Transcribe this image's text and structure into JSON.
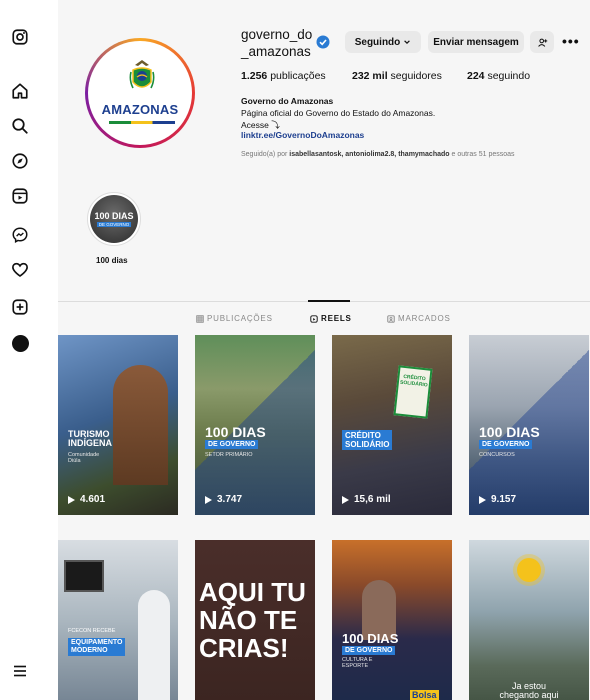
{
  "sidebar": {
    "icons": [
      "instagram-logo-icon",
      "home-icon",
      "search-icon",
      "explore-icon",
      "reels-icon",
      "messenger-icon",
      "heart-icon",
      "create-icon",
      "profile-avatar",
      "menu-icon"
    ]
  },
  "profile": {
    "username": "governo_do\n_amazonas",
    "verified": true,
    "avatar_brand": "AMAZONAS",
    "buttons": {
      "following": "Seguindo",
      "message": "Enviar mensagem"
    },
    "stats": {
      "posts": "1.256",
      "posts_label": "publicações",
      "followers": "232 mil",
      "followers_label": "seguidores",
      "following": "224",
      "following_label": "seguindo"
    },
    "bio": {
      "name": "Governo do Amazonas",
      "line1": "Página oficial do Governo do Estado do Amazonas.",
      "line2": "Acesse ⤵",
      "link": "linktr.ee/GovernoDoAmazonas"
    },
    "followed_by": {
      "prefix": "Seguido(a) por ",
      "names": "isabellasantosk, antoniolima2.8, thamymachado",
      "suffix": " e outras 51 pessoas"
    }
  },
  "highlights": [
    {
      "title_big": "100 DIAS",
      "title_small": "DE GOVERNO",
      "label": "100 dias"
    }
  ],
  "tabs": [
    {
      "label": "PUBLICAÇÕES",
      "active": false
    },
    {
      "label": "REELS",
      "active": true
    },
    {
      "label": "MARCADOS",
      "active": false
    }
  ],
  "reels": [
    {
      "title": "TURISMO\nINDÍGENA",
      "sub": "Comunidade\nDiúla",
      "views": "4.601"
    },
    {
      "title": "100 DIAS",
      "pill": "DE GOVERNO",
      "sub": "SETOR PRIMÁRIO",
      "views": "3.747"
    },
    {
      "title": "CRÉDITO\nSOLIDÁRIO",
      "sign": "CRÉDITO\nSOLIDÁRIO",
      "views": "15,6 mil"
    },
    {
      "title": "100 DIAS",
      "pill": "DE GOVERNO",
      "sub": "CONCURSOS",
      "views": "9.157"
    },
    {
      "title": "EQUIPAMENTO\nMODERNO",
      "sub": "FCECON RECEBE"
    },
    {
      "title": "AQUI TU\nNÃO TE\nCRIAS!"
    },
    {
      "title": "100 DIAS",
      "pill": "DE GOVERNO",
      "sub": "CULTURA E\nESPORTE",
      "brand": "Bolsa"
    },
    {
      "title": "Ja estou\nchegando aqui"
    }
  ],
  "colors": {
    "accent_blue": "#2a7bd3",
    "brand_navy": "#1d3f8f",
    "flag_green": "#1b8d3a",
    "flag_yellow": "#f4c21b"
  }
}
